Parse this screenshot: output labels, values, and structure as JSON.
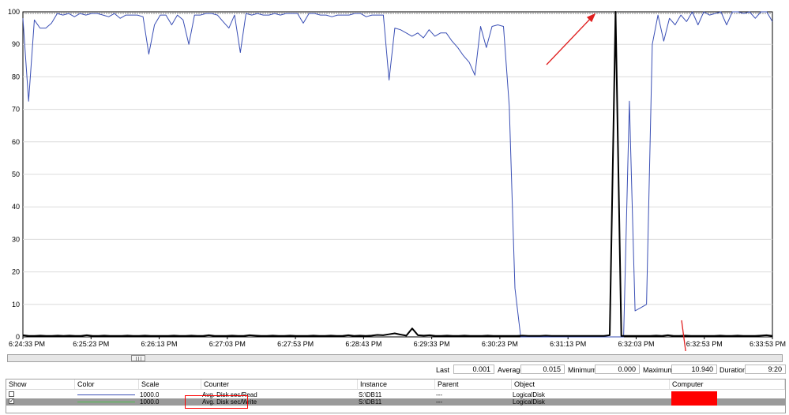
{
  "chart_data": {
    "type": "line",
    "ylim": [
      0,
      100
    ],
    "y_ticks": [
      "0",
      "10",
      "20",
      "30",
      "40",
      "50",
      "60",
      "70",
      "80",
      "90",
      "100"
    ],
    "x_ticks": [
      "6:24:33 PM",
      "6:25:23 PM",
      "6:26:13 PM",
      "6:27:03 PM",
      "6:27:53 PM",
      "6:28:43 PM",
      "6:29:33 PM",
      "6:30:23 PM",
      "6:31:13 PM",
      "6:32:03 PM",
      "6:32:53 PM",
      "6:33:53 PM"
    ],
    "grid": true,
    "series": [
      {
        "name": "Avg. Disk sec/Read",
        "color": "#3a4fb5",
        "values": [
          98,
          72.5,
          97.5,
          95,
          95,
          96.5,
          99.5,
          99,
          99.5,
          98.5,
          99.5,
          99,
          99.5,
          99.5,
          99,
          98.5,
          99.5,
          98,
          99,
          99,
          99,
          98.5,
          87,
          96,
          99,
          99,
          96,
          99,
          97.5,
          90,
          99,
          99,
          99.5,
          99.5,
          99,
          97,
          95,
          99,
          87.5,
          99.5,
          99,
          99.5,
          99,
          99,
          99.5,
          99,
          99.5,
          99.5,
          99.5,
          96.5,
          99.5,
          99.5,
          99,
          99,
          98.5,
          99,
          99,
          99,
          99.5,
          99.5,
          98.5,
          99,
          99,
          99,
          79,
          95,
          94.5,
          93.5,
          92.5,
          93.5,
          92,
          94.5,
          92.5,
          93.5,
          93.5,
          91,
          89,
          86.5,
          84.5,
          80.5,
          95.5,
          89,
          95.5,
          96,
          95.5,
          71,
          15,
          0,
          0,
          0,
          0,
          0,
          0,
          0,
          0,
          0,
          0,
          0,
          0,
          0,
          0,
          0,
          0,
          0,
          0,
          0,
          72.5,
          8,
          9,
          10,
          90,
          99,
          91,
          98,
          96,
          99,
          97,
          100,
          96,
          100,
          99,
          99.5,
          100,
          96,
          100,
          100,
          99.5,
          100,
          98,
          100,
          100,
          97
        ]
      },
      {
        "name": "Avg. Disk sec/Write",
        "color": "#000000",
        "values": [
          0.5,
          0.3,
          0.3,
          0.4,
          0.3,
          0.3,
          0.4,
          0.3,
          0.4,
          0.3,
          0.3,
          0.5,
          0.3,
          0.3,
          0.4,
          0.3,
          0.3,
          0.3,
          0.4,
          0.3,
          0.3,
          0.4,
          0.3,
          0.3,
          0.3,
          0.3,
          0.4,
          0.3,
          0.3,
          0.4,
          0.3,
          0.3,
          0.5,
          0.3,
          0.3,
          0.3,
          0.4,
          0.3,
          0.3,
          0.5,
          0.4,
          0.3,
          0.3,
          0.4,
          0.3,
          0.3,
          0.4,
          0.3,
          0.3,
          0.3,
          0.4,
          0.3,
          0.3,
          0.4,
          0.3,
          0.3,
          0.5,
          0.3,
          0.4,
          0.3,
          0.4,
          0.6,
          0.5,
          0.8,
          1.1,
          0.7,
          0.4,
          2.6,
          0.5,
          0.4,
          0.5,
          0.3,
          0.3,
          0.4,
          0.3,
          0.3,
          0.4,
          0.3,
          0.3,
          0.3,
          0.4,
          0.3,
          0.3,
          0.3,
          0.3,
          0.3,
          0.4,
          0.3,
          0.3,
          0.3,
          0.4,
          0.3,
          0.3,
          0.3,
          0.3,
          0.3,
          0.3,
          0.3,
          0.3,
          0.3,
          0.3,
          0.5,
          100,
          0.3,
          0.3,
          0.3,
          0.3,
          0.3,
          0.3,
          0.4,
          0.3,
          0.5,
          0.3,
          0.3,
          0.4,
          0.3,
          0.3,
          0.3,
          0.3,
          0.3,
          0.4,
          0.3,
          0.3,
          0.4,
          0.3,
          0.3,
          0.3,
          0.4,
          0.5,
          0.3
        ]
      }
    ]
  },
  "stats": {
    "last_label": "Last",
    "last_value": "0.001",
    "average_label": "Average",
    "average_value": "0.015",
    "minimum_label": "Minimum",
    "minimum_value": "0.000",
    "maximum_label": "Maximum",
    "maximum_value": "10.940",
    "duration_label": "Duration",
    "duration_value": "9:20"
  },
  "legend": {
    "headers": {
      "show": "Show",
      "color": "Color",
      "scale": "Scale",
      "counter": "Counter",
      "instance": "Instance",
      "parent": "Parent",
      "object": "Object",
      "computer": "Computer"
    },
    "rows": [
      {
        "show": false,
        "color": "#3a4fb5",
        "scale": "1000.0",
        "counter": "Avg. Disk sec/Read",
        "instance": "S:\\DB11",
        "parent": "---",
        "object": "LogicalDisk"
      },
      {
        "show": true,
        "color": "#4fbf4f",
        "scale": "1000.0",
        "counter": "Avg. Disk sec/Write",
        "instance": "S:\\DB11",
        "parent": "---",
        "object": "LogicalDisk"
      }
    ]
  },
  "annotations": {
    "arrow_color": "#e02020",
    "redaction_color": "#ff0000"
  }
}
